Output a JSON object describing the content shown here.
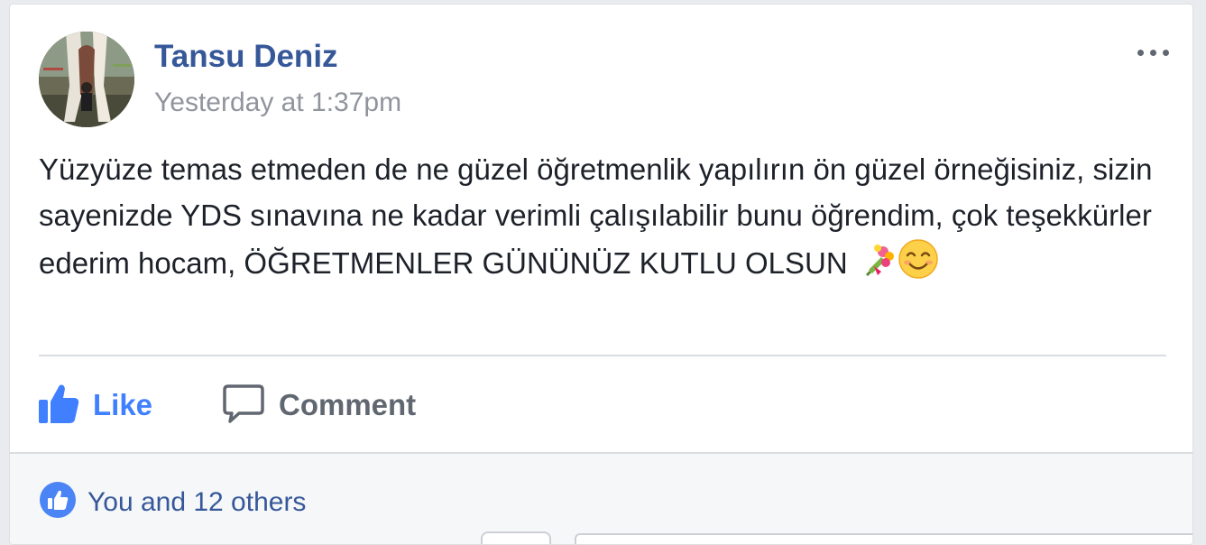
{
  "post": {
    "author_name": "Tansu Deniz",
    "timestamp": "Yesterday at 1:37pm",
    "text": "Yüzyüze temas etmeden de ne güzel öğretmenlik yapılırın ön güzel örneğisiniz, sizin sayenizde YDS sınavına ne kadar verimli çalışılabilir bunu öğrendim, çok teşekkürler ederim hocam, ÖĞRETMENLER GÜNÜNÜZ KUTLU OLSUN",
    "emojis": [
      "bouquet-emoji",
      "smiling-face-emoji"
    ],
    "more_icon": "ellipsis-icon"
  },
  "actions": {
    "like_label": "Like",
    "comment_label": "Comment",
    "like_icon": "thumbs-up-icon",
    "comment_icon": "speech-bubble-icon"
  },
  "reactions": {
    "summary": "You and 12 others",
    "icon": "like-badge-icon"
  },
  "colors": {
    "author_link": "#365899",
    "like_active": "#4080ff",
    "secondary_text": "#90949c",
    "body_text": "#1d2129",
    "action_gray": "#606770"
  }
}
